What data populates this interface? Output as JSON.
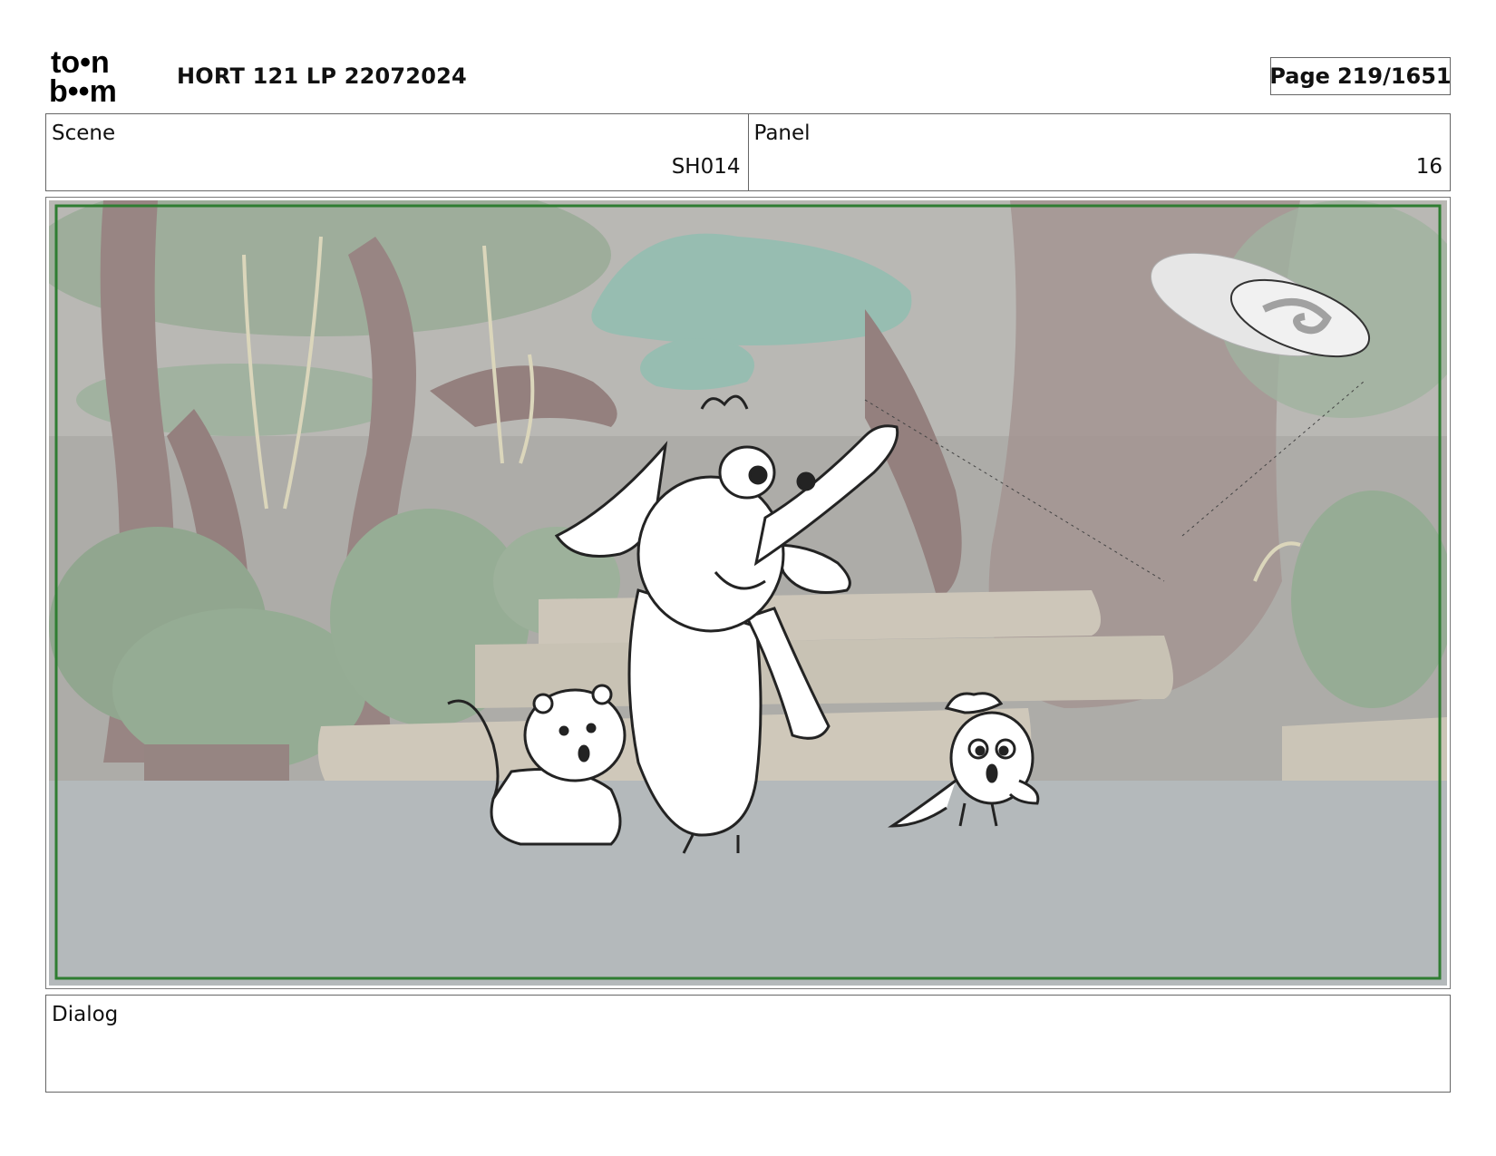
{
  "header": {
    "logo_top": "to•n",
    "logo_bottom": "b••m",
    "doc_title": "HORT 121 LP 22072024",
    "page_label": "Page",
    "page_value": "219/1651"
  },
  "info": {
    "scene_label": "Scene",
    "scene_value": "SH014",
    "panel_label": "Panel",
    "panel_value": "16"
  },
  "panel_image": {
    "description_icon": "storyboard-drawing",
    "safe_frame_color": "#2f7d32"
  },
  "dialog": {
    "label": "Dialog",
    "text": ""
  }
}
